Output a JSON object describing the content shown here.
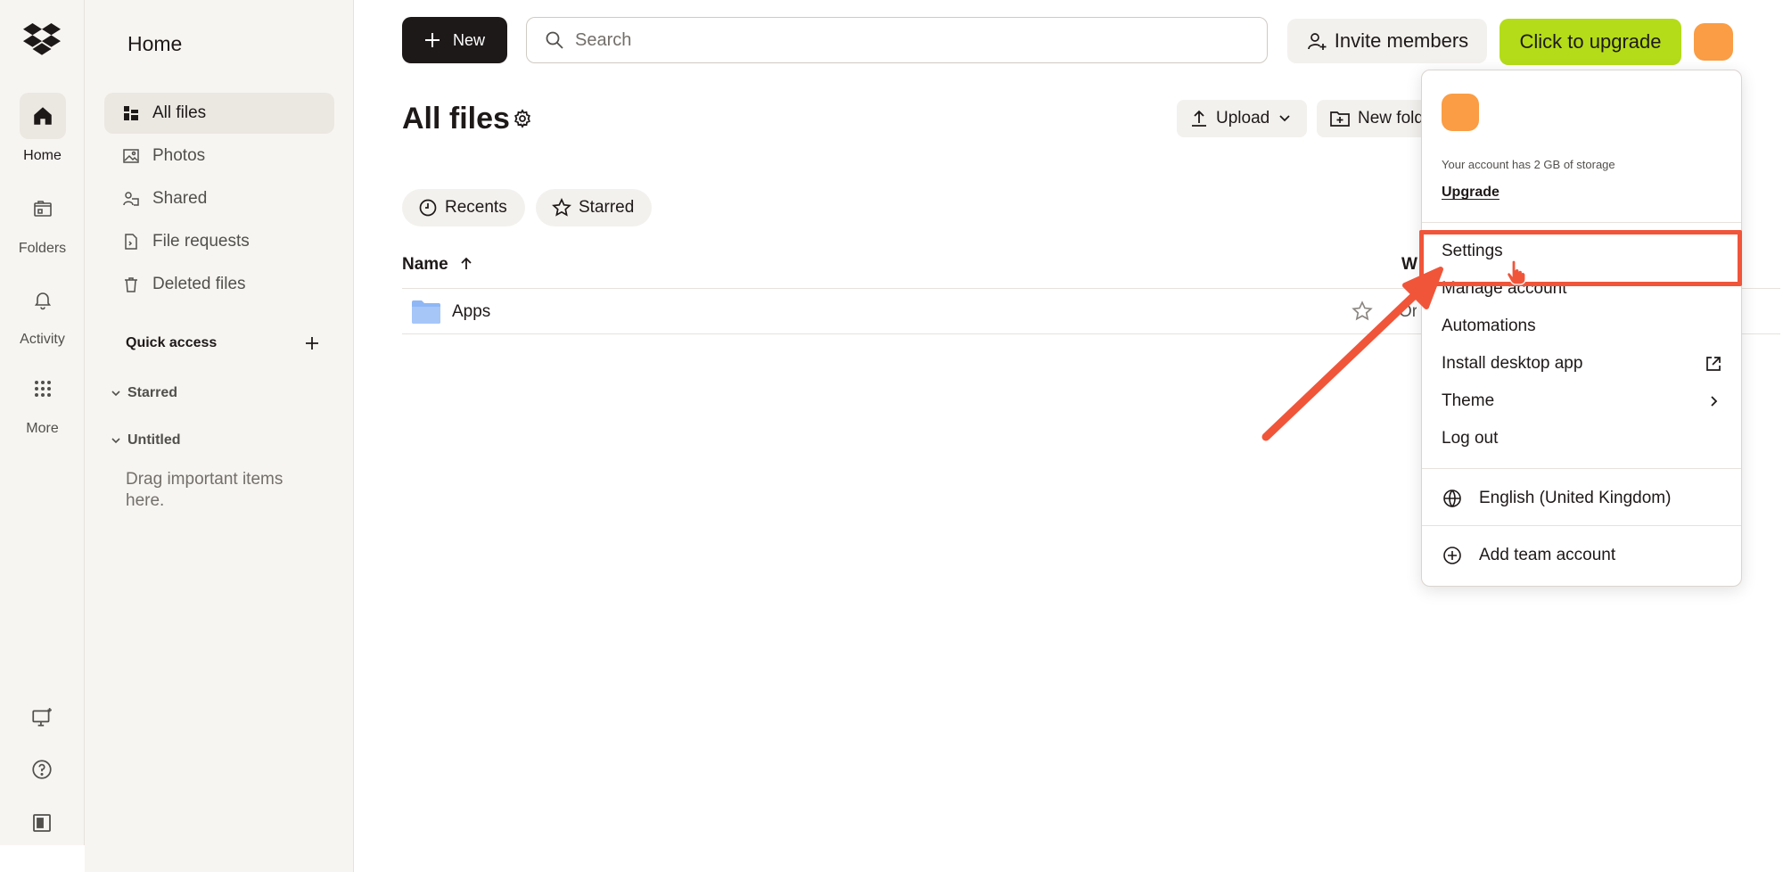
{
  "rail": {
    "items": [
      {
        "label": "Home",
        "icon": "home-icon",
        "active": true
      },
      {
        "label": "Folders",
        "icon": "folders-icon"
      },
      {
        "label": "Activity",
        "icon": "bell-icon"
      },
      {
        "label": "More",
        "icon": "grid-icon"
      }
    ],
    "bottom_icons": [
      "desktop-icon",
      "help-icon",
      "panel-icon"
    ]
  },
  "sidebar": {
    "title": "Home",
    "items": [
      {
        "label": "All files",
        "icon": "all-files-icon",
        "active": true
      },
      {
        "label": "Photos",
        "icon": "photos-icon"
      },
      {
        "label": "Shared",
        "icon": "shared-icon"
      },
      {
        "label": "File requests",
        "icon": "file-requests-icon"
      },
      {
        "label": "Deleted files",
        "icon": "trash-icon"
      }
    ],
    "quick_access": "Quick access",
    "starred": "Starred",
    "untitled": "Untitled",
    "drag_hint": "Drag important items here."
  },
  "topbar": {
    "new_label": "New",
    "search_placeholder": "Search",
    "invite_label": "Invite members",
    "upgrade_label": "Click to upgrade"
  },
  "main": {
    "title": "All files",
    "upload_label": "Upload",
    "new_folder_label": "New folder",
    "chips": [
      {
        "label": "Recents",
        "icon": "clock-icon"
      },
      {
        "label": "Starred",
        "icon": "star-icon"
      }
    ],
    "columns": {
      "name": "Name",
      "second": "W"
    },
    "rows": [
      {
        "name": "Apps",
        "fragment": "Or"
      }
    ]
  },
  "menu": {
    "storage_text": "Your account has 2 GB of storage",
    "upgrade_link": "Upgrade",
    "items": [
      {
        "label": "Settings"
      },
      {
        "label": "Manage account"
      },
      {
        "label": "Automations"
      },
      {
        "label": "Install desktop app",
        "tail_icon": "external-link-icon"
      },
      {
        "label": "Theme",
        "tail_icon": "chevron-right-icon"
      },
      {
        "label": "Log out"
      }
    ],
    "language": "English (United Kingdom)",
    "add_team": "Add team account"
  },
  "colors": {
    "accent_upgrade": "#b4dc19",
    "avatar": "#fa9d45",
    "annotation": "#f0553a",
    "folder": "#8fb7f5"
  }
}
